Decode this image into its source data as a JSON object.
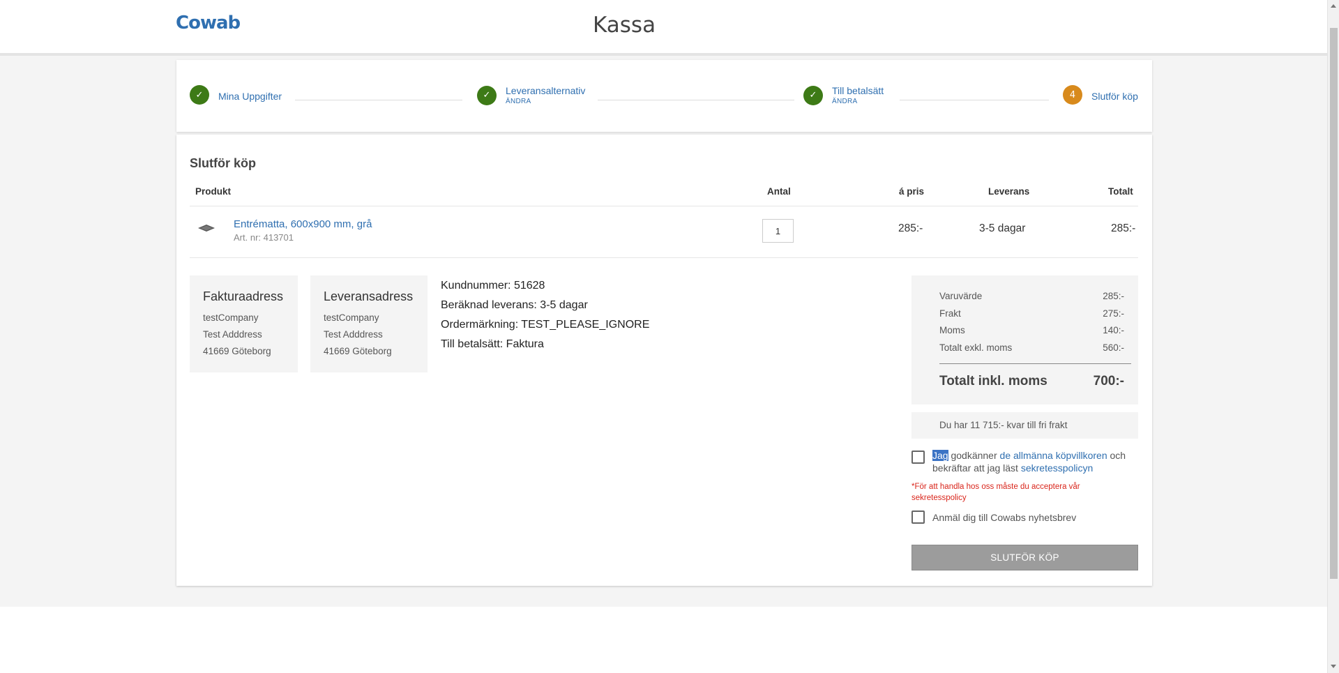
{
  "header": {
    "logo": "Cowab",
    "title": "Kassa"
  },
  "stepper": {
    "steps": [
      {
        "label": "Mina Uppgifter",
        "edit": ""
      },
      {
        "label": "Leveransalternativ",
        "edit": "ÄNDRA"
      },
      {
        "label": "Till betalsätt",
        "edit": "ÄNDRA"
      },
      {
        "label": "Slutför köp",
        "number": "4"
      }
    ]
  },
  "main": {
    "section_title": "Slutför köp",
    "columns": {
      "product": "Produkt",
      "quantity": "Antal",
      "unit_price": "á pris",
      "delivery": "Leverans",
      "total": "Totalt"
    },
    "product": {
      "name": "Entrématta, 600x900 mm, grå",
      "art_nr": "Art. nr: 413701",
      "quantity": "1",
      "unit_price": "285:-",
      "delivery": "3-5 dagar",
      "total": "285:-"
    },
    "billing_address": {
      "title": "Fakturaadress",
      "company": "testCompany",
      "street": "Test Adddress",
      "city": "41669 Göteborg"
    },
    "delivery_address": {
      "title": "Leveransadress",
      "company": "testCompany",
      "street": "Test Adddress",
      "city": "41669 Göteborg"
    },
    "order_info": {
      "customer_number": "Kundnummer: 51628",
      "estimated_delivery": "Beräknad leverans: 3-5 dagar",
      "order_marking": "Ordermärkning: TEST_PLEASE_IGNORE",
      "payment_method": "Till betalsätt: Faktura"
    },
    "summary": {
      "rows": [
        {
          "label": "Varuvärde",
          "value": "285:-"
        },
        {
          "label": "Frakt",
          "value": "275:-"
        },
        {
          "label": "Moms",
          "value": "140:-"
        },
        {
          "label": "Totalt exkl. moms",
          "value": "560:-"
        }
      ],
      "total_label": "Totalt inkl. moms",
      "total_value": "700:-"
    },
    "free_shipping": "Du har 11 715:- kvar till fri frakt",
    "terms": {
      "highlight_word": "Jag",
      "text_before_link1": " godkänner ",
      "link1": "de allmänna köpvillkoren",
      "text_between": " och bekräftar att jag läst ",
      "link2": "sekretesspolicyn",
      "warning": "*För att handla hos oss måste du acceptera vår sekretesspolicy",
      "checked": false
    },
    "newsletter": {
      "label": "Anmäl dig till Cowabs nyhetsbrev",
      "checked": false
    },
    "submit_label": "SLUTFÖR KÖP"
  },
  "colors": {
    "brand_blue": "#2f6fb0",
    "step_done": "#3d7a16",
    "step_active": "#d88a1c",
    "warning_red": "#d9251b",
    "button_disabled": "#9c9c9c"
  }
}
